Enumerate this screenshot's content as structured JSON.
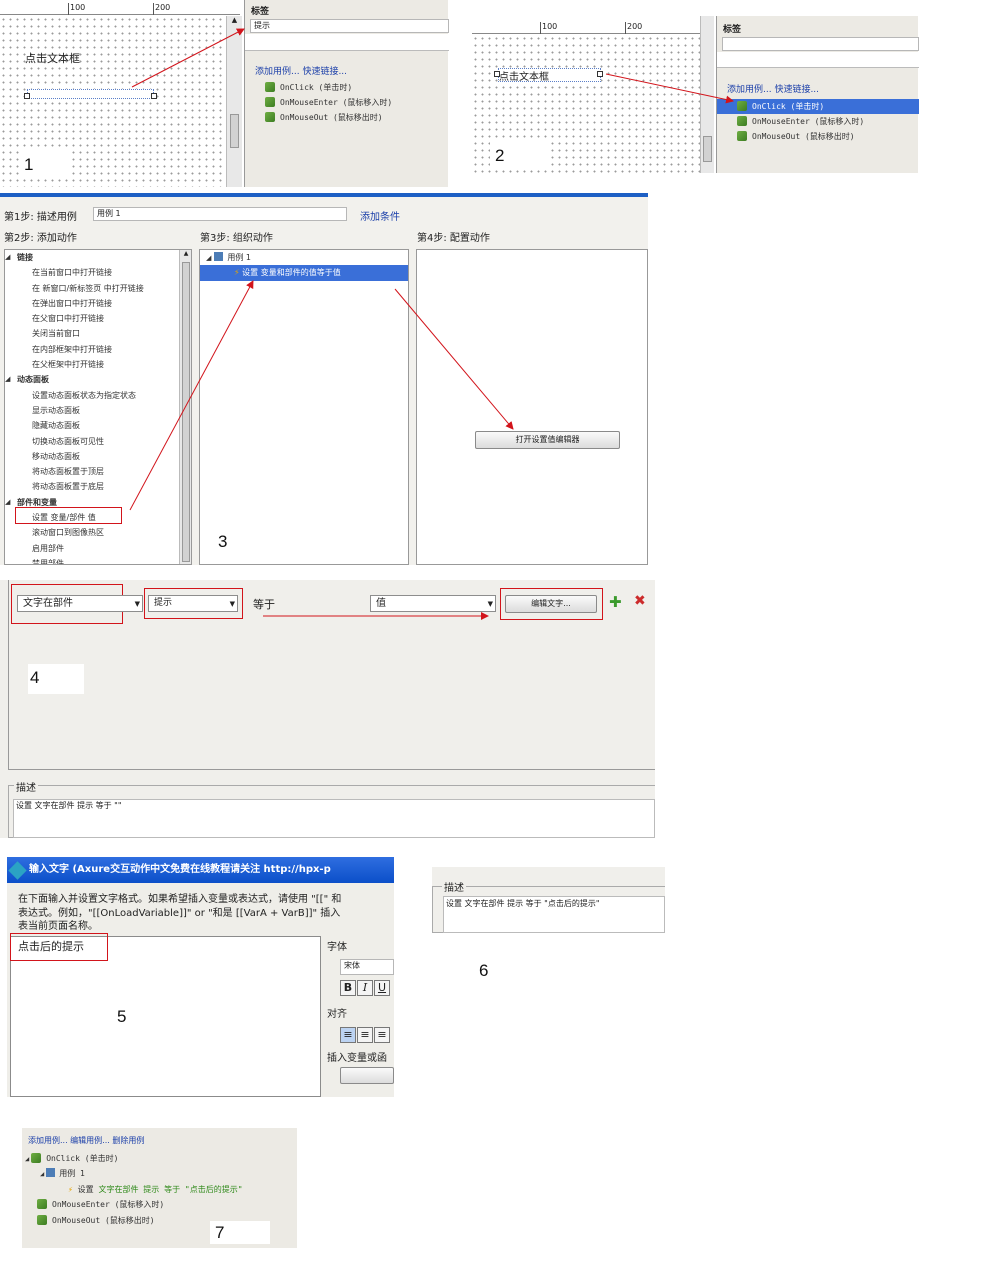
{
  "s1": {
    "ruler": [
      "100",
      "200"
    ],
    "widget_label": "点击文本框",
    "panel_title": "标签",
    "label_value": "提示",
    "actions": "添加用例...  快速链接...",
    "events": [
      "OnClick (单击时)",
      "OnMouseEnter (鼠标移入时)",
      "OnMouseOut (鼠标移出时)"
    ],
    "num": "1"
  },
  "s2": {
    "ruler": [
      "100",
      "200"
    ],
    "widget_label": "点击文本框",
    "panel_title": "标签",
    "actions": "添加用例...  快速链接...",
    "events": [
      "OnClick (单击时)",
      "OnMouseEnter (鼠标移入时)",
      "OnMouseOut (鼠标移出时)"
    ],
    "num": "2"
  },
  "s3": {
    "step1_label": "第1步: 描述用例",
    "case_name": "用例 1",
    "add_condition": "添加条件",
    "step2_label": "第2步: 添加动作",
    "step3_label": "第3步: 组织动作",
    "step4_label": "第4步: 配置动作",
    "groups": [
      {
        "title": "链接",
        "items": [
          "在当前窗口中打开链接",
          "在 新窗口/新标签页 中打开链接",
          "在弹出窗口中打开链接",
          "在父窗口中打开链接",
          "关闭当前窗口",
          "在内部框架中打开链接",
          "在父框架中打开链接"
        ]
      },
      {
        "title": "动态面板",
        "items": [
          "设置动态面板状态为指定状态",
          "显示动态面板",
          "隐藏动态面板",
          "切换动态面板可见性",
          "移动动态面板",
          "将动态面板置于顶层",
          "将动态面板置于底层"
        ]
      },
      {
        "title": "部件和变量",
        "items": [
          "设置 变量/部件 值",
          "滚动窗口到图像热区",
          "启用部件",
          "禁用部件"
        ]
      }
    ],
    "tree_case": "用例 1",
    "tree_action": "设置 变量和部件的值等于值",
    "open_btn": "打开设置值编辑器",
    "num": "3"
  },
  "s4": {
    "target_type": "文字在部件",
    "target_widget": "提示",
    "equals": "等于",
    "value_type": "值",
    "edit_btn": "编辑文字...",
    "desc_label": "描述",
    "desc_text": "设置 文字在部件 提示 等于 \"\"",
    "num": "4"
  },
  "s5": {
    "title": "输入文字 (Axure交互动作中文免费在线教程请关注 http://hpx-p",
    "instr1": "在下面输入并设置文字格式。如果希望插入变量或表达式，请使用 \"[[\" 和",
    "instr2": "表达式。例如，\"[[OnLoadVariable]]\" or \"和是 [[VarA + VarB]]\" 插入",
    "instr3": "表当前页面名称。",
    "text": "点击后的提示",
    "font_label": "字体",
    "font_value": "宋体",
    "align_label": "对齐",
    "insert_label": "插入变量或函",
    "num": "5"
  },
  "s6": {
    "desc_label": "描述",
    "desc_text": "设置 文字在部件 提示 等于 \"点击后的提示\"",
    "num": "6"
  },
  "s7": {
    "actions": "添加用例...  编辑用例...  删除用例",
    "onclick": "OnClick (单击时)",
    "case": "用例 1",
    "action_prefix": "设置",
    "action_detail": "文字在部件 提示 等于 \"点击后的提示\"",
    "enter": "OnMouseEnter (鼠标移入时)",
    "out": "OnMouseOut (鼠标移出时)",
    "num": "7"
  },
  "colors": {
    "select": "#3a6fd8",
    "arrow": "#d2141b",
    "link": "#1b3fa9",
    "panel": "#eceae4"
  }
}
